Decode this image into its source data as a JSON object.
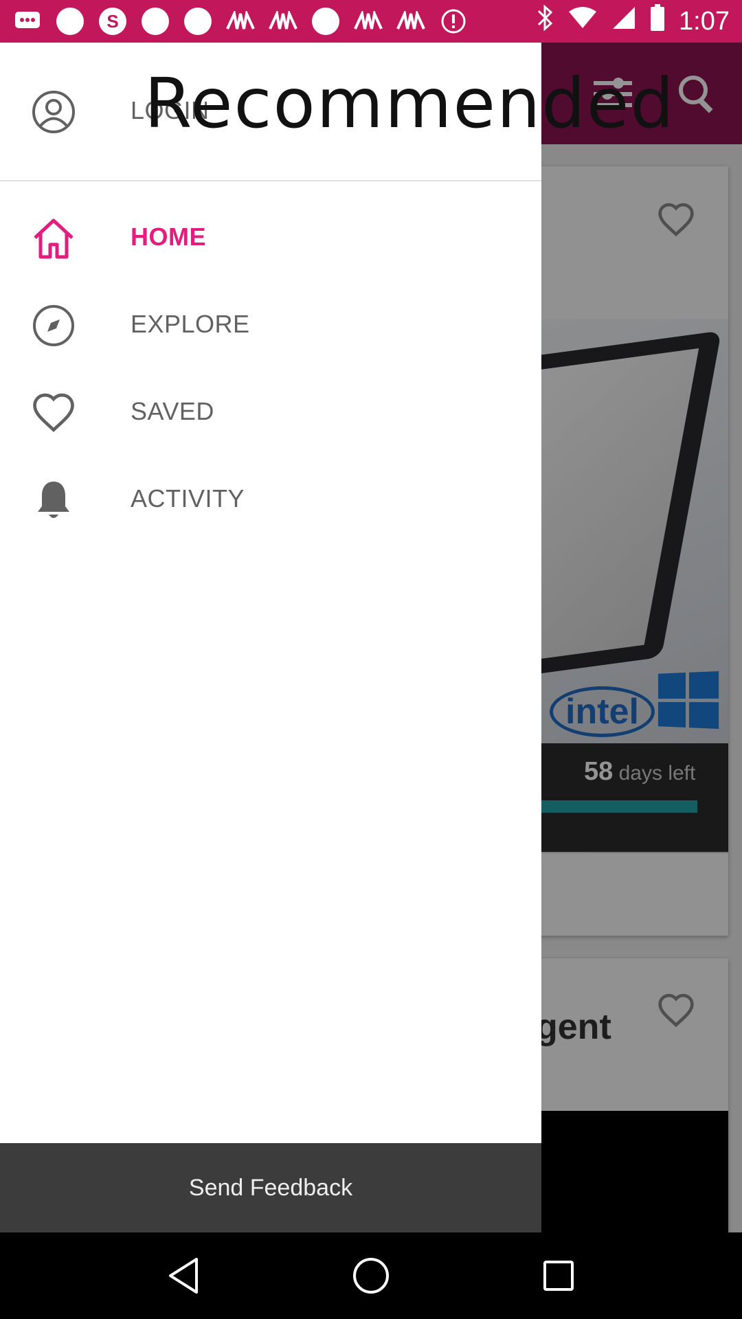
{
  "status_bar": {
    "time": "1:07",
    "background": "#c2185b",
    "left_icons": [
      "chat-icon",
      "circle-icon",
      "s-icon",
      "circle-icon",
      "circle-icon",
      "bird-icon",
      "bird-icon",
      "circle-icon",
      "bird-icon",
      "bird-icon",
      "alert-icon"
    ],
    "right_icons": [
      "bluetooth-icon",
      "wifi-icon",
      "signal-icon",
      "battery-icon"
    ]
  },
  "overlay": {
    "title": "Recommended"
  },
  "drawer": {
    "login_label": "LOGIN",
    "accent": "#e21d7d",
    "items": [
      {
        "label": "HOME",
        "icon": "home-icon",
        "active": true
      },
      {
        "label": "EXPLORE",
        "icon": "compass-icon",
        "active": false
      },
      {
        "label": "SAVED",
        "icon": "heart-icon",
        "active": false
      },
      {
        "label": "ACTIVITY",
        "icon": "bell-icon",
        "active": false
      }
    ],
    "feedback_label": "Send Feedback"
  },
  "background_app": {
    "app_bar_color": "#8a1450",
    "card1": {
      "days_number": "58",
      "days_text": "days left",
      "logo_text": "intel",
      "progress": 0.85
    },
    "card2": {
      "title_fragment": "gent"
    }
  },
  "nav_bar": {
    "buttons": [
      "back-icon",
      "home-circle-icon",
      "recents-icon"
    ]
  }
}
